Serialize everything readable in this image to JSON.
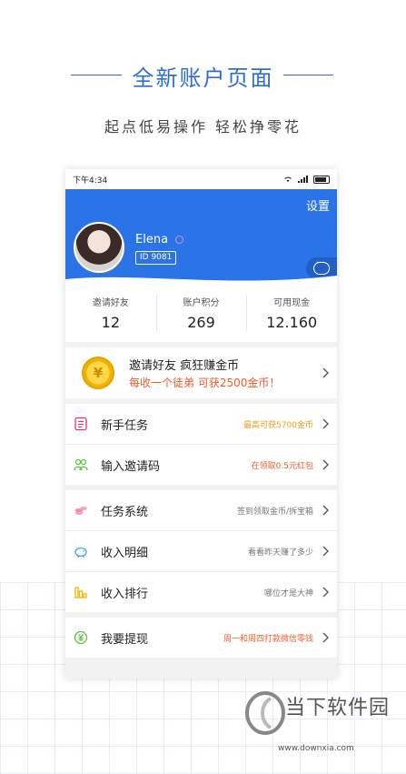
{
  "promo": {
    "title": "全新账户页面",
    "subtitle": "起点低易操作  轻松挣零花"
  },
  "status_bar": {
    "time": "下午4:34"
  },
  "profile": {
    "settings_label": "设置",
    "name": "Elena",
    "id": "ID 9081"
  },
  "stats": [
    {
      "label": "邀请好友",
      "value": "12"
    },
    {
      "label": "账户积分",
      "value": "269"
    },
    {
      "label": "可用现金",
      "value": "12.160"
    }
  ],
  "invite": {
    "coin_symbol": "¥",
    "title": "邀请好友  疯狂赚金币",
    "subtitle": "每收一个徒弟  可获2500金币！"
  },
  "menu_group_1": [
    {
      "label": "新手任务",
      "hint": "最高可获5700金币",
      "icon": "task-list-icon"
    },
    {
      "label": "输入邀请码",
      "hint": "在领取0.5元红包",
      "icon": "people-icon"
    }
  ],
  "menu_group_2": [
    {
      "label": "任务系统",
      "hint": "签到领取金币/拆宝箱",
      "icon": "coins-icon"
    },
    {
      "label": "收入明细",
      "hint": "看看昨天赚了多少",
      "icon": "piggy-bank-icon"
    },
    {
      "label": "收入排行",
      "hint": "哪位才是大神",
      "icon": "bar-chart-icon"
    }
  ],
  "menu_group_3": [
    {
      "label": "我要提现",
      "hint": "周一和周四打款微信零钱",
      "icon": "yuan-icon"
    }
  ],
  "footer": {
    "brand": "当下软件园",
    "url": "www.downxia.com"
  },
  "colors": {
    "brand_blue": "#2b74e8",
    "accent_orange": "#f29c11",
    "accent_red": "#f25a2a"
  }
}
